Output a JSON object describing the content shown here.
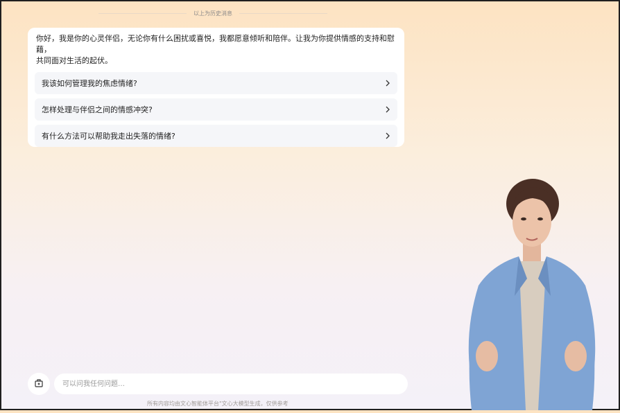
{
  "history": {
    "label": "以上为历史消息"
  },
  "chat": {
    "greeting": "你好，我是你的心灵伴侣，无论你有什么困扰或喜悦，我都愿意倾听和陪伴。让我为你提供情感的支持和慰藉，\n共同面对生活的起伏。",
    "suggestions": [
      {
        "label": "我该如何管理我的焦虑情绪?"
      },
      {
        "label": "怎样处理与伴侣之间的情感冲突?"
      },
      {
        "label": "有什么方法可以帮助我走出失落的情绪?"
      }
    ]
  },
  "composer": {
    "placeholder": "可以问我任何问题…",
    "tool_icon": "new-chat-icon"
  },
  "footer": {
    "note": "所有内容均由文心智能体平台\"文心大模型生成，仅供参考"
  },
  "avatar": {
    "description_icon": "digital-human-avatar"
  },
  "colors": {
    "bg_top": "#fde3c2",
    "bg_bottom": "#f4f1f8",
    "card": "#ffffff",
    "suggestion_bg": "#f5f6f9",
    "blazer": "#7fa4d4"
  }
}
